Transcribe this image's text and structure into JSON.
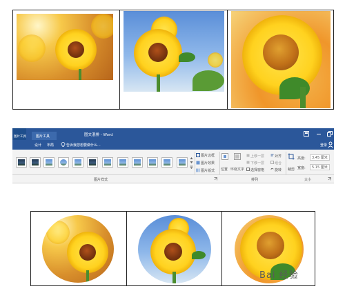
{
  "ribbon": {
    "context_tab": "图片工具",
    "context_sub_tab": "格式",
    "doc_title": "图文混排 - Word",
    "tabs": {
      "design": "设计",
      "layout": "布局"
    },
    "tell_me": "告诉我您想要做什么...",
    "sign_in": "登录",
    "commands": {
      "picture_border": "图片边框",
      "picture_effects": "图片效果",
      "picture_layout": "图片版式",
      "position": "位置",
      "wrap_text": "环绕文字",
      "bring_forward": "上移一层",
      "send_backward": "下移一层",
      "selection_pane": "选择窗格",
      "align": "对齐",
      "group": "组合",
      "rotate": "旋转",
      "crop": "裁剪",
      "height_label": "高度:",
      "height_value": "3.45 厘米",
      "width_label": "宽度:",
      "width_value": "5.15 厘米"
    },
    "groups": {
      "picture_styles": "图片样式",
      "arrange": "排列",
      "size": "大小"
    }
  },
  "watermark": "Bai 经验",
  "icons": [
    "search-icon",
    "user-icon",
    "restore-icon",
    "minimize-icon",
    "close-icon"
  ]
}
